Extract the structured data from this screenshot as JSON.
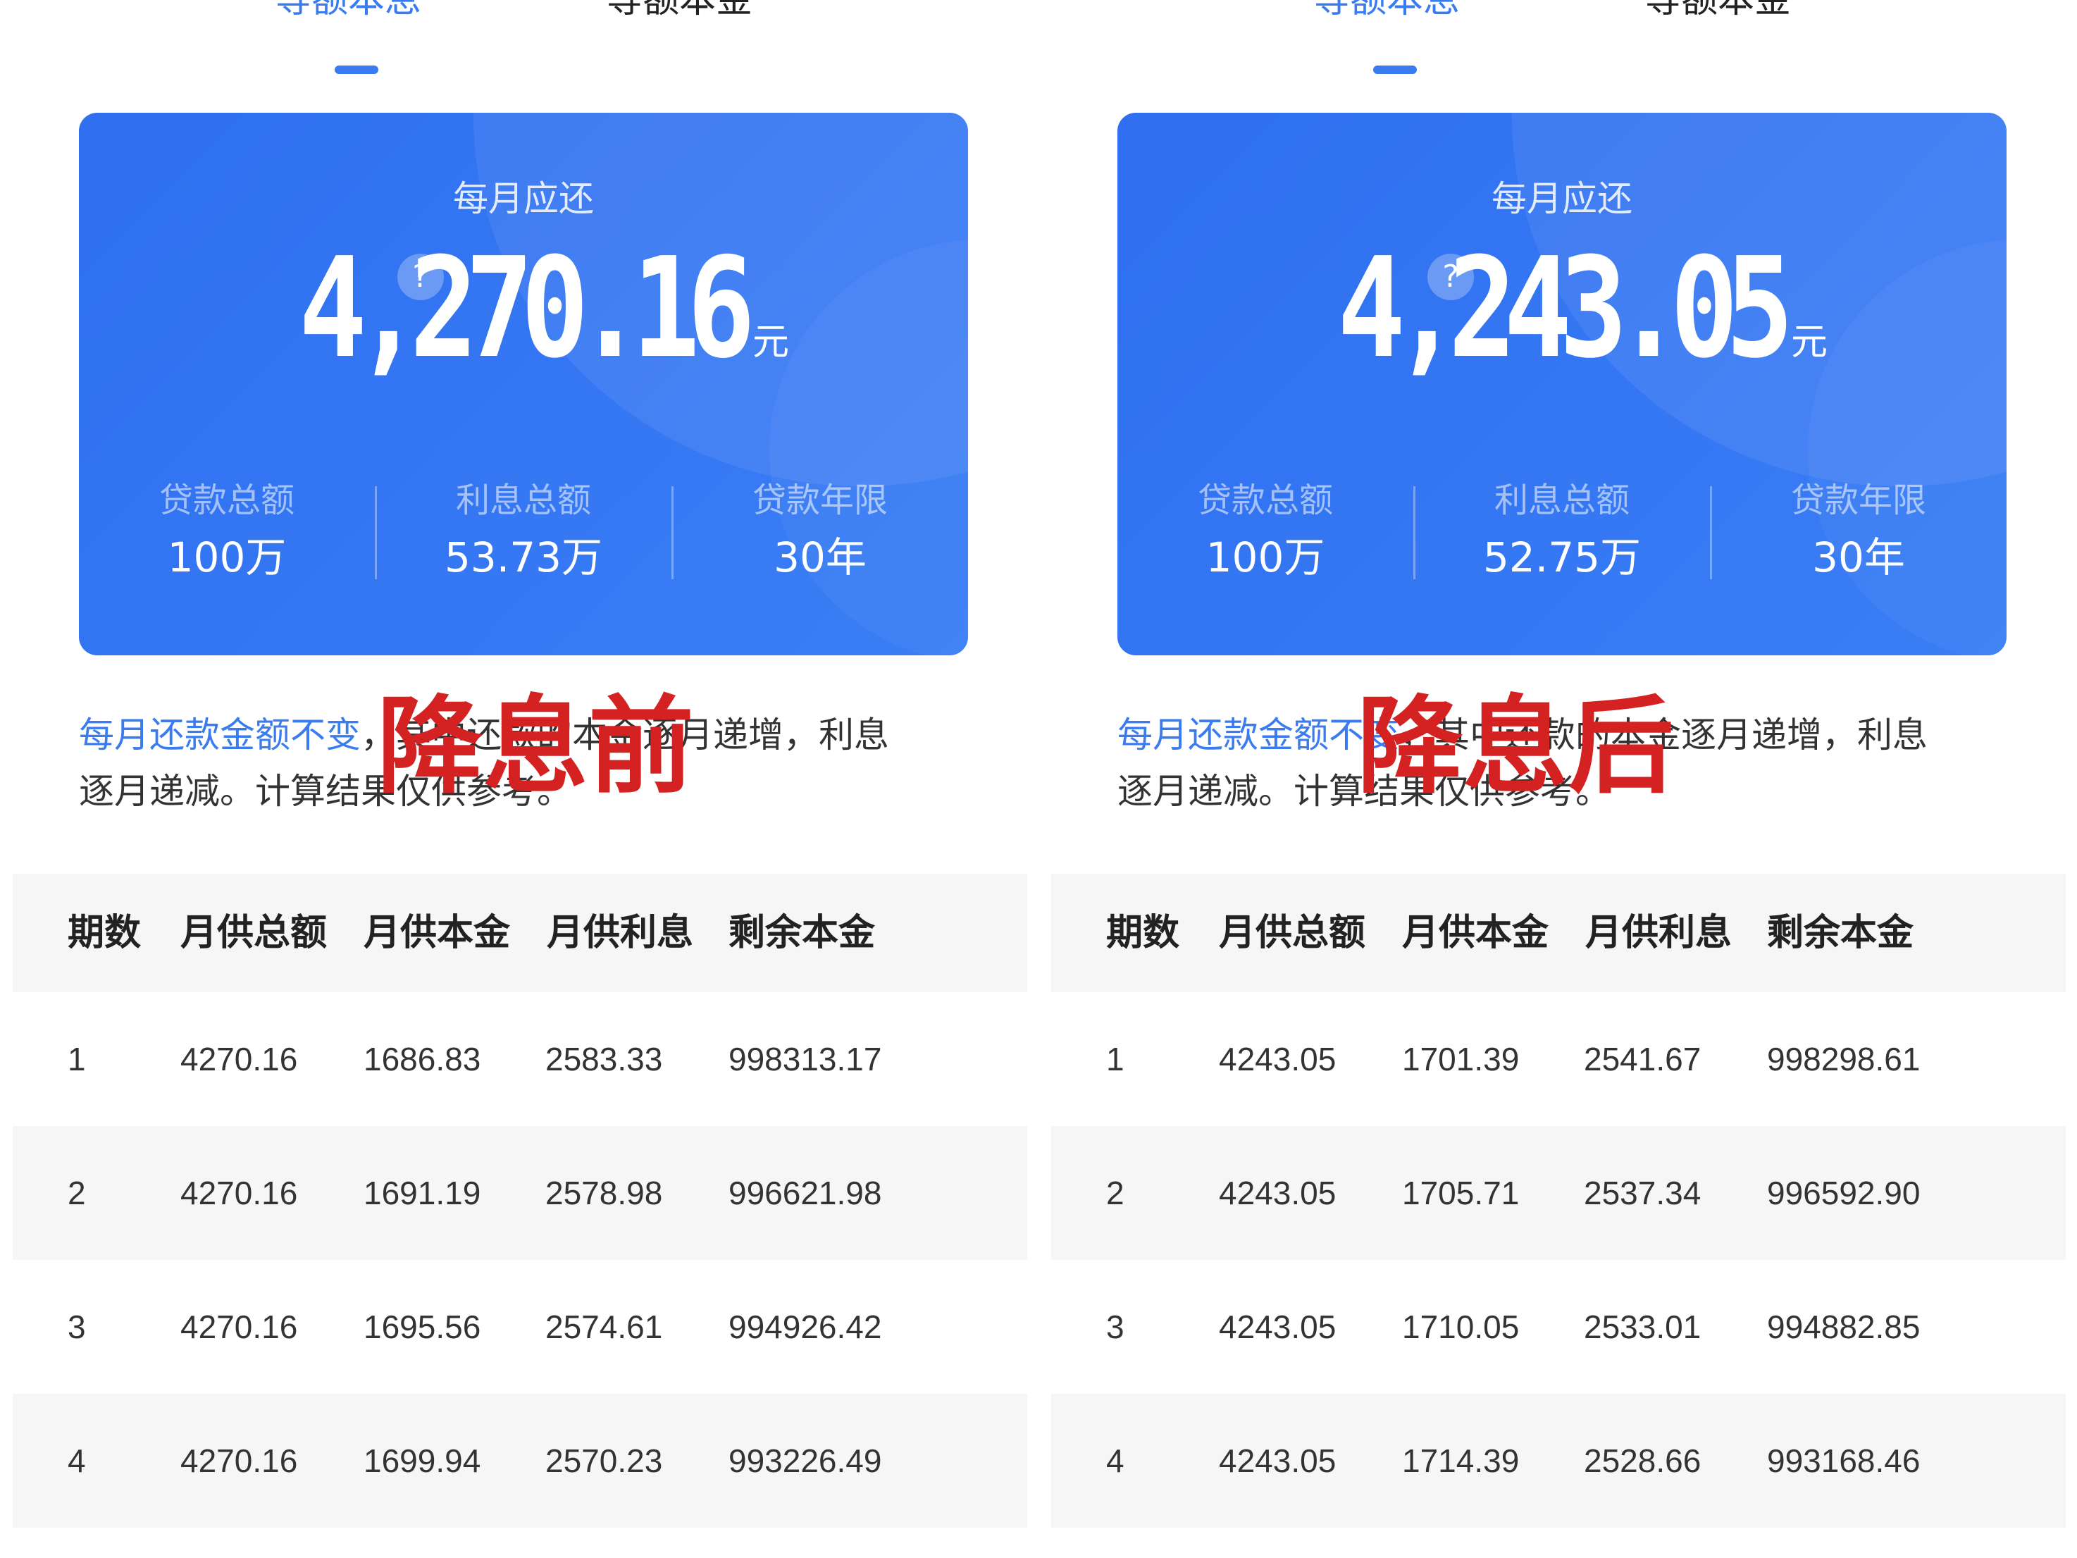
{
  "panels": [
    {
      "tabs": {
        "active_label": "等额本息",
        "inactive_label": "等额本金"
      },
      "card": {
        "title": "每月应还",
        "amount": "4,270.16",
        "unit": "元",
        "help_glyph": "?",
        "stats": [
          {
            "label": "贷款总额",
            "value": "100万"
          },
          {
            "label": "利息总额",
            "value": "53.73万"
          },
          {
            "label": "贷款年限",
            "value": "30年"
          }
        ]
      },
      "description": {
        "highlight": "每月还款金额不变",
        "rest_line1": "，其中还款的本金逐月递增，利息",
        "line2": "逐月递减。计算结果仅供参考。"
      },
      "annotation": "降息前",
      "table": {
        "headers": [
          "期数",
          "月供总额",
          "月供本金",
          "月供利息",
          "剩余本金"
        ],
        "rows": [
          [
            "1",
            "4270.16",
            "1686.83",
            "2583.33",
            "998313.17"
          ],
          [
            "2",
            "4270.16",
            "1691.19",
            "2578.98",
            "996621.98"
          ],
          [
            "3",
            "4270.16",
            "1695.56",
            "2574.61",
            "994926.42"
          ],
          [
            "4",
            "4270.16",
            "1699.94",
            "2570.23",
            "993226.49"
          ]
        ]
      }
    },
    {
      "tabs": {
        "active_label": "等额本息",
        "inactive_label": "等额本金"
      },
      "card": {
        "title": "每月应还",
        "amount": "4,243.05",
        "unit": "元",
        "help_glyph": "?",
        "stats": [
          {
            "label": "贷款总额",
            "value": "100万"
          },
          {
            "label": "利息总额",
            "value": "52.75万"
          },
          {
            "label": "贷款年限",
            "value": "30年"
          }
        ]
      },
      "description": {
        "highlight": "每月还款金额不变",
        "rest_line1": "，其中还款的本金逐月递增，利息",
        "line2": "逐月递减。计算结果仅供参考。"
      },
      "annotation": "降息后",
      "table": {
        "headers": [
          "期数",
          "月供总额",
          "月供本金",
          "月供利息",
          "剩余本金"
        ],
        "rows": [
          [
            "1",
            "4243.05",
            "1701.39",
            "2541.67",
            "998298.61"
          ],
          [
            "2",
            "4243.05",
            "1705.71",
            "2537.34",
            "996592.90"
          ],
          [
            "3",
            "4243.05",
            "1710.05",
            "2533.01",
            "994882.85"
          ],
          [
            "4",
            "4243.05",
            "1714.39",
            "2528.66",
            "993168.46"
          ]
        ]
      }
    }
  ],
  "colors": {
    "accent": "#3a7cf0",
    "card_blue": "#3577f3",
    "annotation_red": "#d42222",
    "table_stripe": "#f6f6f6"
  }
}
